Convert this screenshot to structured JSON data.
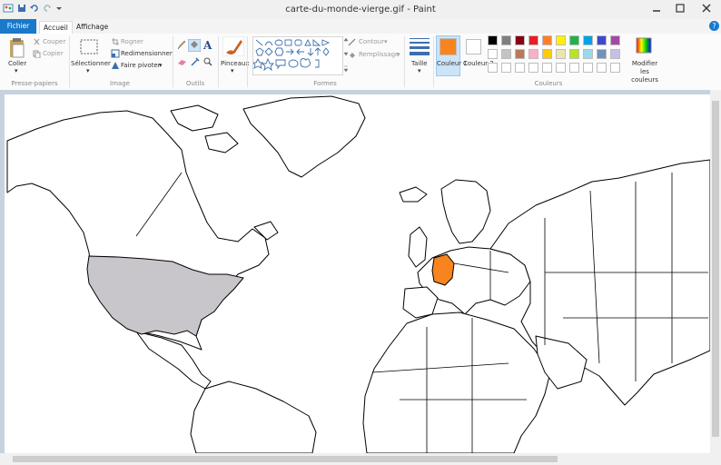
{
  "window": {
    "title": "carte-du-monde-vierge.gif - Paint"
  },
  "menu": {
    "file": "Fichier",
    "home": "Accueil",
    "view": "Affichage"
  },
  "ribbon": {
    "clipboard": {
      "paste": "Coller",
      "cut": "Couper",
      "copy": "Copier",
      "label": "Presse-papiers"
    },
    "image": {
      "select": "Sélectionner",
      "crop": "Rogner",
      "resize": "Redimensionner",
      "rotate": "Faire pivoter",
      "label": "Image"
    },
    "tools": {
      "label": "Outils"
    },
    "brushes": {
      "label": "Pinceaux"
    },
    "shapes": {
      "outline": "Contour",
      "fill": "Remplissage",
      "label": "Formes"
    },
    "size": {
      "label": "Taille"
    },
    "colors": {
      "color1": "Couleur 1",
      "color2": "Couleur 2",
      "edit": "Modifier les couleurs",
      "label": "Couleurs",
      "color1_value": "#f7841f",
      "color2_value": "#ffffff",
      "palette_row1": [
        "#000000",
        "#7f7f7f",
        "#880015",
        "#ed1c24",
        "#ff7f27",
        "#fff200",
        "#22b14c",
        "#00a2e8",
        "#3f48cc",
        "#a349a4"
      ],
      "palette_row2": [
        "#ffffff",
        "#c3c3c3",
        "#b97a57",
        "#ffaec9",
        "#ffc90e",
        "#efe4b0",
        "#b5e61d",
        "#99d9ea",
        "#7092be",
        "#c8bfe7"
      ]
    }
  },
  "map": {
    "highlight_usa": "#c8c6cb",
    "highlight_germany": "#f7841f"
  }
}
